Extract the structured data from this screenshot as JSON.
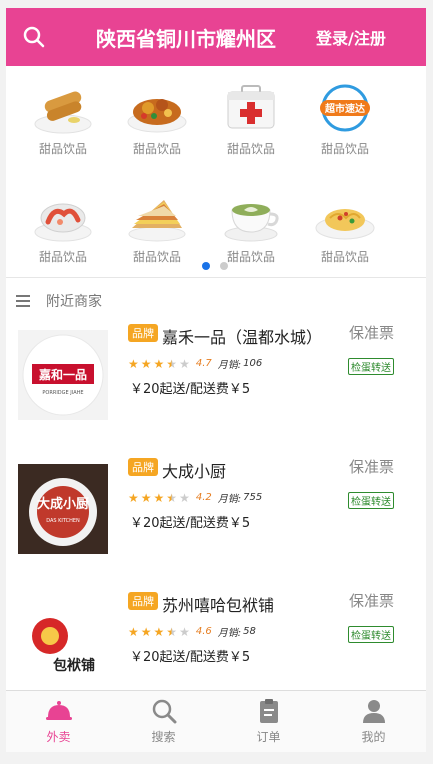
{
  "header": {
    "title": "陕西省铜川市耀州区",
    "login": "登录/注册"
  },
  "categories": [
    {
      "label": "甜品饮品",
      "icon": "spring-roll-icon"
    },
    {
      "label": "甜品饮品",
      "icon": "chicken-dish-icon"
    },
    {
      "label": "甜品饮品",
      "icon": "first-aid-kit-icon"
    },
    {
      "label": "甜品饮品",
      "icon": "supermarket-express-icon",
      "badge": "超市速达"
    },
    {
      "label": "甜品饮品",
      "icon": "shrimp-dish-icon"
    },
    {
      "label": "甜品饮品",
      "icon": "sandwich-icon"
    },
    {
      "label": "甜品饮品",
      "icon": "latte-cup-icon"
    },
    {
      "label": "甜品饮品",
      "icon": "pasta-dish-icon"
    }
  ],
  "colors": {
    "accent": "#e84393",
    "star": "#f5a623",
    "dot_active": "#1a73e8",
    "dot_inactive": "#cccccc"
  },
  "nearby": {
    "title": "附近商家"
  },
  "shops": [
    {
      "brand": "品牌",
      "name": "嘉禾一品（温都水城）",
      "rating": "4.7",
      "sales_label": "月销:",
      "sales": "106",
      "fee": "￥20起送/配送费￥5",
      "guarantee": "保准票",
      "check": "检蛋转送",
      "stars": 3.5,
      "logo_text": "嘉和一品",
      "logo_sub": "PORRIDGE JIAHE"
    },
    {
      "brand": "品牌",
      "name": "大成小厨",
      "rating": "4.2",
      "sales_label": "月销:",
      "sales": "755",
      "fee": "￥20起送/配送费￥5",
      "guarantee": "保准票",
      "check": "检蛋转送",
      "stars": 3.5,
      "logo_text": "大成小厨",
      "logo_sub": "DAS KITCHEN"
    },
    {
      "brand": "品牌",
      "name": "苏州嘻哈包袱铺",
      "rating": "4.6",
      "sales_label": "月销:",
      "sales": "58",
      "fee": "￥20起送/配送费￥5",
      "guarantee": "保准票",
      "check": "检蛋转送",
      "stars": 3.5,
      "logo_text": "包袱铺",
      "logo_sub": ""
    }
  ],
  "tabs": [
    {
      "label": "外卖",
      "icon": "food-cloche-icon",
      "active": true
    },
    {
      "label": "搜索",
      "icon": "search-icon",
      "active": false
    },
    {
      "label": "订单",
      "icon": "order-clipboard-icon",
      "active": false
    },
    {
      "label": "我的",
      "icon": "user-icon",
      "active": false
    }
  ]
}
